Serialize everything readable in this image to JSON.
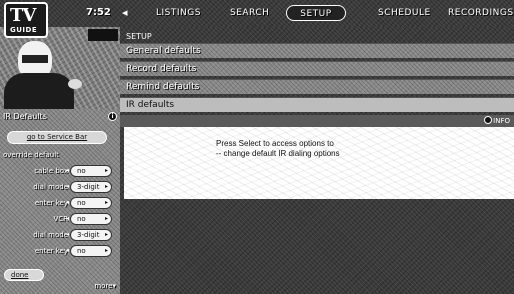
{
  "logo": {
    "line1": "TV",
    "line2": "GUIDE"
  },
  "header": {
    "time": "7:52",
    "nav_arrow": "◂",
    "tabs": [
      "LISTINGS",
      "SEARCH",
      "SETUP",
      "SCHEDULE",
      "RECORDINGS"
    ]
  },
  "left_panel": {
    "title": "IR Defaults",
    "info_icon": "info-icon",
    "service_bar_button": "go to Service Bar",
    "override_label": "override default",
    "options": [
      {
        "label": "cable box",
        "value": "no"
      },
      {
        "label": "dial mode",
        "value": "3-digit"
      },
      {
        "label": "enter key",
        "value": "no"
      },
      {
        "label": "VCR",
        "value": "no"
      },
      {
        "label": "dial mode",
        "value": "3-digit"
      },
      {
        "label": "enter key",
        "value": "no"
      }
    ],
    "done_button": "done",
    "more_label": "more▾"
  },
  "main": {
    "heading": "SETUP",
    "menu": [
      "General defaults",
      "Record defaults",
      "Remind defaults",
      "IR defaults"
    ],
    "info_label": "INFO",
    "info_lines": [
      "Press Select to access options to",
      "-- change default IR dialing options"
    ]
  },
  "colors": {
    "selected_row": "#bdbdbd",
    "panel_background": "#8a8a8a",
    "dark_background": "#3a3a3a"
  }
}
